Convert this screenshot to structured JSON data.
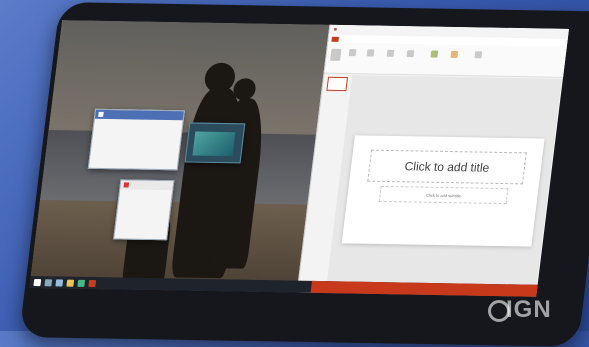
{
  "ppt": {
    "title_placeholder": "Click to add title",
    "subtitle_placeholder": "Click to add subtitle"
  },
  "watermark": "IGN",
  "colors": {
    "background": "#3c5db3",
    "tablet": "#15171c",
    "ppt_accent": "#c43e1c",
    "taskbar": "#1e232c"
  },
  "icons": [
    "start-icon",
    "search-icon",
    "task-view-icon",
    "explorer-icon",
    "store-icon",
    "powerpoint-icon"
  ]
}
